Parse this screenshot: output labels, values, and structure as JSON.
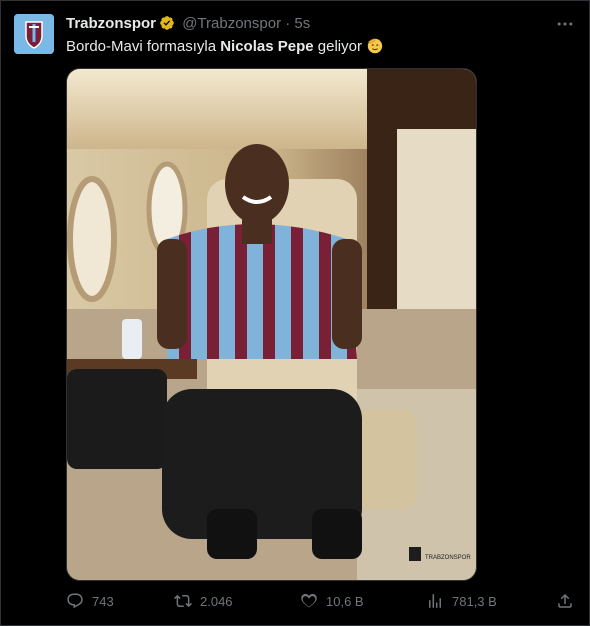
{
  "account": {
    "name": "Trabzonspor",
    "handle": "@Trabzonspor",
    "separator": "·",
    "time": "5s",
    "verified": true,
    "avatar_icon": "trabzonspor-crest-icon"
  },
  "tweet": {
    "text_before": "Bordo-Mavi formasıyla ",
    "text_bold": "Nicolas Pepe",
    "text_after": " geliyor",
    "emoji": "saluting-face-emoji"
  },
  "media": {
    "watermark_label": "TRABZONSPOR"
  },
  "actions": {
    "replies": "743",
    "retweets": "2.046",
    "likes": "10,6 B",
    "views": "781,3 B"
  },
  "colors": {
    "background": "#000000",
    "text": "#e7e9ea",
    "muted": "#71767b",
    "verified_gold": "#e2b719",
    "border": "#2f3336"
  }
}
